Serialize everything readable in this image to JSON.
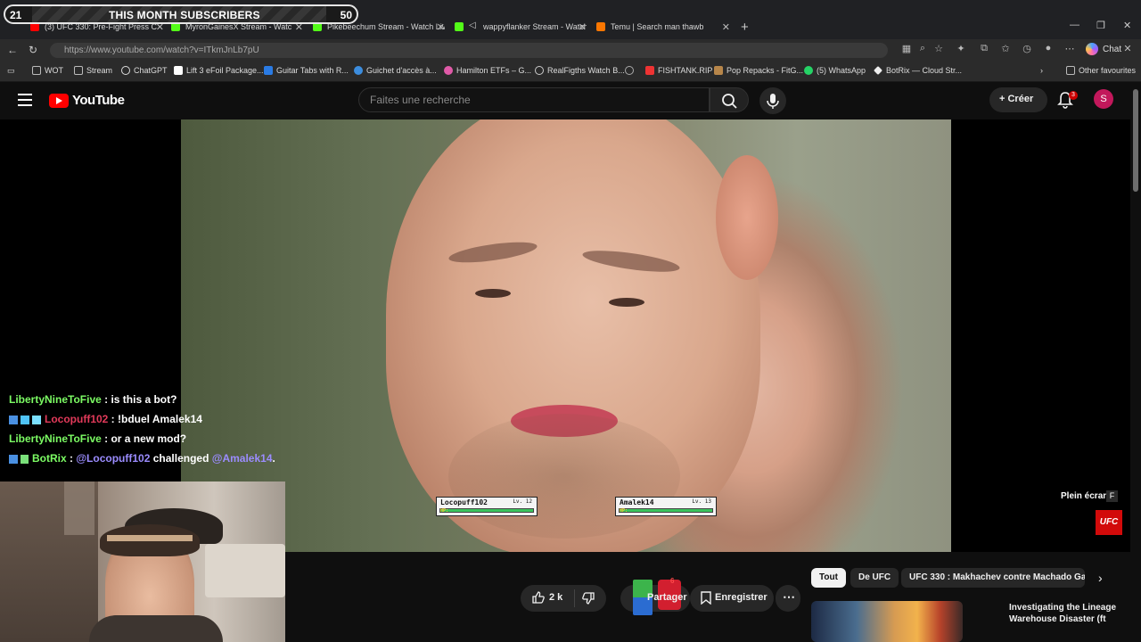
{
  "stream_widget": {
    "left_count": "21",
    "label": "THIS MONTH SUBSCRIBERS",
    "right_count": "50"
  },
  "tabs": [
    {
      "label": "(3) UFC 330: Pre-Fight Press C",
      "color": "#ff0000"
    },
    {
      "label": "MyronGainesX Stream - Watc",
      "color": "#53fc18"
    },
    {
      "label": "Pikebeechum Stream - Watch Live",
      "color": "#53fc18"
    },
    {
      "label": "wappyflanker Stream - Watch",
      "color": "#53fc18"
    },
    {
      "label": "Temu | Search man thawb",
      "color": "#fb7701"
    }
  ],
  "browser": {
    "url": "https://www.youtube.com/watch?v=ITkmJnLb7pU",
    "chat_label": "Chat",
    "other_favourites": "Other favourites"
  },
  "bookmarks": [
    {
      "label": "WOT",
      "color": "#888"
    },
    {
      "label": "Stream",
      "color": "#888"
    },
    {
      "label": "ChatGPT",
      "color": "#ddd"
    },
    {
      "label": "Lift 3 eFoil Package...",
      "color": "#fff"
    },
    {
      "label": "Guitar Tabs with R...",
      "color": "#2a7be4"
    },
    {
      "label": "Guichet d'accès à...",
      "color": "#3c8dde"
    },
    {
      "label": "Hamilton ETFs – G...",
      "color": "#e05aa8"
    },
    {
      "label": "RealFigths Watch B...",
      "color": "#ccc"
    },
    {
      "label": "",
      "color": "#aaa"
    },
    {
      "label": "FISHTANK.RIP",
      "color": "#e33"
    },
    {
      "label": "Pop Repacks - FitG...",
      "color": "#b7864a"
    },
    {
      "label": "(5) WhatsApp",
      "color": "#25d366"
    },
    {
      "label": "BotRix — Cloud Str...",
      "color": "#eee"
    }
  ],
  "youtube": {
    "logo_text": "YouTube",
    "search_placeholder": "Faites une recherche",
    "create_label": "Créer",
    "notifications_count": "3",
    "avatar_letter": "S"
  },
  "video_overlay": {
    "player1": {
      "name": "Locopuff102",
      "level": "Lv. 12",
      "hp": "HP:"
    },
    "player2": {
      "name": "Amalek14",
      "level": "Lv. 13",
      "hp": "HP:"
    },
    "fullscreen_hint": "Plein écran",
    "fullscreen_key": "F",
    "channel_badge": "UFC"
  },
  "chat": [
    {
      "user": "LibertyNineToFive",
      "user_color": "#7cfc64",
      "message": " : is this a bot?"
    },
    {
      "user": "Locopuff102",
      "user_color": "#e23a5a",
      "message": " : !bduel Amalek14"
    },
    {
      "user": "LibertyNineToFive",
      "user_color": "#7cfc64",
      "message": " : or a new mod?"
    },
    {
      "user": "BotRix",
      "user_color": "#7cfc64",
      "message_prefix": " : ",
      "mention1": "@Locopuff102",
      "middle": " challenged ",
      "mention2": "@Amalek14",
      "suffix": ".",
      "mention_color": "#9b8cff"
    }
  ],
  "actions": {
    "likes": "2 k",
    "share_label": "Partager",
    "share_badge": "6",
    "save_label": "Enregistrer"
  },
  "chips": [
    "Tout",
    "De UFC",
    "UFC 330 : Makhachev contre Machado Ga"
  ],
  "recommendation": {
    "title": "Investigating the Lineage Warehouse Disaster (ft"
  }
}
